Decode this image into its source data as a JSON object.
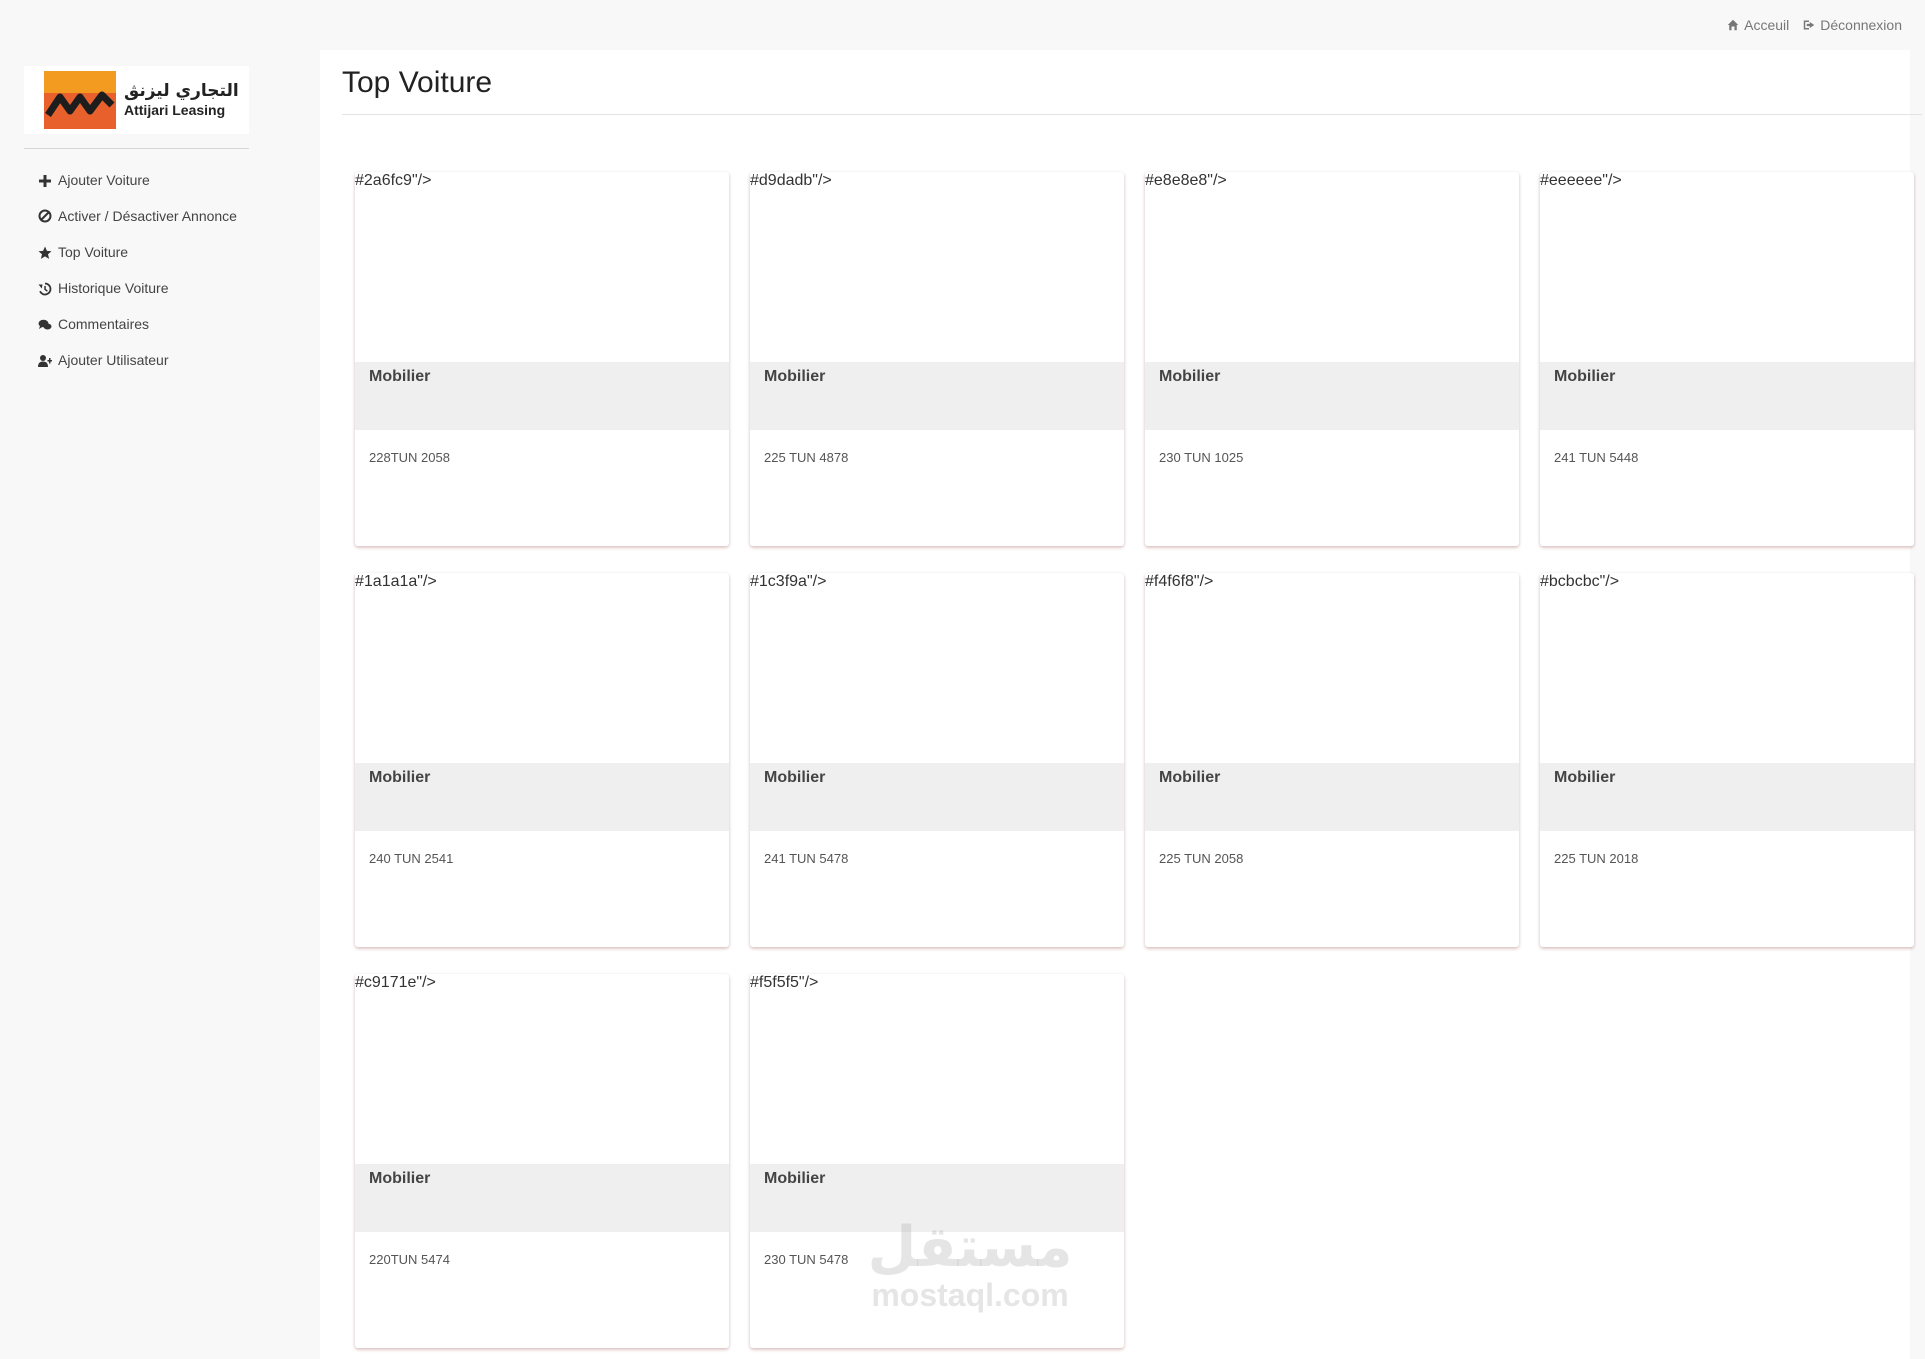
{
  "topbar": {
    "home_label": "Acceuil",
    "logout_label": "Déconnexion"
  },
  "logo": {
    "arabic": "التجاري ليزنڨ",
    "name": "Attijari Leasing"
  },
  "menu": [
    {
      "label": "Ajouter Voiture",
      "icon": "plus-icon"
    },
    {
      "label": "Activer / Désactiver Annonce",
      "icon": "ban-icon"
    },
    {
      "label": "Top Voiture",
      "icon": "star-icon"
    },
    {
      "label": "Historique Voiture",
      "icon": "history-icon"
    },
    {
      "label": "Commentaires",
      "icon": "comments-icon"
    },
    {
      "label": "Ajouter Utilisateur",
      "icon": "user-plus-icon"
    }
  ],
  "page": {
    "title": "Top Voiture"
  },
  "cars": [
    {
      "category": "Mobilier",
      "plate": "228TUN 2058",
      "color": "#2a6fc9"
    },
    {
      "category": "Mobilier",
      "plate": "225 TUN 4878",
      "color": "#d9dadb"
    },
    {
      "category": "Mobilier",
      "plate": "230 TUN 1025",
      "color": "#e8e8e8"
    },
    {
      "category": "Mobilier",
      "plate": "241 TUN 5448",
      "color": "#eeeeee"
    },
    {
      "category": "Mobilier",
      "plate": "240 TUN 2541",
      "color": "#1a1a1a"
    },
    {
      "category": "Mobilier",
      "plate": "241 TUN 5478",
      "color": "#1c3f9a"
    },
    {
      "category": "Mobilier",
      "plate": "225 TUN 2058",
      "color": "#f4f6f8"
    },
    {
      "category": "Mobilier",
      "plate": "225 TUN 2018",
      "color": "#bcbcbc"
    },
    {
      "category": "Mobilier",
      "plate": "220TUN 5474",
      "color": "#c9171e"
    },
    {
      "category": "Mobilier",
      "plate": "230 TUN 5478",
      "color": "#f5f5f5"
    }
  ],
  "watermark": {
    "arabic": "مستقل",
    "latin": "mostaql.com"
  }
}
